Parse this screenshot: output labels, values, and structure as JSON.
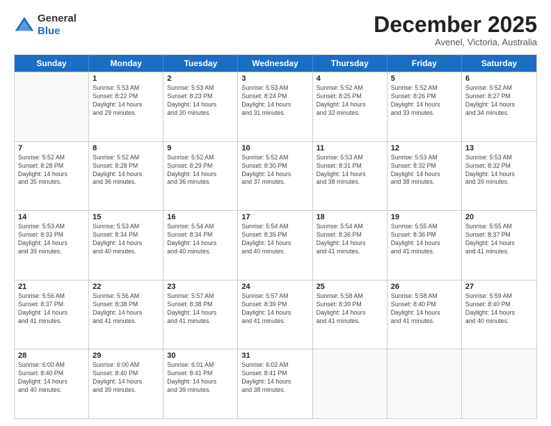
{
  "logo": {
    "general": "General",
    "blue": "Blue"
  },
  "title": "December 2025",
  "subtitle": "Avenel, Victoria, Australia",
  "header_days": [
    "Sunday",
    "Monday",
    "Tuesday",
    "Wednesday",
    "Thursday",
    "Friday",
    "Saturday"
  ],
  "rows": [
    [
      {
        "day": "",
        "info": ""
      },
      {
        "day": "1",
        "info": "Sunrise: 5:53 AM\nSunset: 8:22 PM\nDaylight: 14 hours\nand 29 minutes."
      },
      {
        "day": "2",
        "info": "Sunrise: 5:53 AM\nSunset: 8:23 PM\nDaylight: 14 hours\nand 30 minutes."
      },
      {
        "day": "3",
        "info": "Sunrise: 5:53 AM\nSunset: 8:24 PM\nDaylight: 14 hours\nand 31 minutes."
      },
      {
        "day": "4",
        "info": "Sunrise: 5:52 AM\nSunset: 8:25 PM\nDaylight: 14 hours\nand 32 minutes."
      },
      {
        "day": "5",
        "info": "Sunrise: 5:52 AM\nSunset: 8:26 PM\nDaylight: 14 hours\nand 33 minutes."
      },
      {
        "day": "6",
        "info": "Sunrise: 5:52 AM\nSunset: 8:27 PM\nDaylight: 14 hours\nand 34 minutes."
      }
    ],
    [
      {
        "day": "7",
        "info": "Sunrise: 5:52 AM\nSunset: 8:28 PM\nDaylight: 14 hours\nand 35 minutes."
      },
      {
        "day": "8",
        "info": "Sunrise: 5:52 AM\nSunset: 8:28 PM\nDaylight: 14 hours\nand 36 minutes."
      },
      {
        "day": "9",
        "info": "Sunrise: 5:52 AM\nSunset: 8:29 PM\nDaylight: 14 hours\nand 36 minutes."
      },
      {
        "day": "10",
        "info": "Sunrise: 5:52 AM\nSunset: 8:30 PM\nDaylight: 14 hours\nand 37 minutes."
      },
      {
        "day": "11",
        "info": "Sunrise: 5:53 AM\nSunset: 8:31 PM\nDaylight: 14 hours\nand 38 minutes."
      },
      {
        "day": "12",
        "info": "Sunrise: 5:53 AM\nSunset: 8:32 PM\nDaylight: 14 hours\nand 38 minutes."
      },
      {
        "day": "13",
        "info": "Sunrise: 5:53 AM\nSunset: 8:32 PM\nDaylight: 14 hours\nand 39 minutes."
      }
    ],
    [
      {
        "day": "14",
        "info": "Sunrise: 5:53 AM\nSunset: 8:33 PM\nDaylight: 14 hours\nand 39 minutes."
      },
      {
        "day": "15",
        "info": "Sunrise: 5:53 AM\nSunset: 8:34 PM\nDaylight: 14 hours\nand 40 minutes."
      },
      {
        "day": "16",
        "info": "Sunrise: 5:54 AM\nSunset: 8:34 PM\nDaylight: 14 hours\nand 40 minutes."
      },
      {
        "day": "17",
        "info": "Sunrise: 5:54 AM\nSunset: 8:35 PM\nDaylight: 14 hours\nand 40 minutes."
      },
      {
        "day": "18",
        "info": "Sunrise: 5:54 AM\nSunset: 8:36 PM\nDaylight: 14 hours\nand 41 minutes."
      },
      {
        "day": "19",
        "info": "Sunrise: 5:55 AM\nSunset: 8:36 PM\nDaylight: 14 hours\nand 41 minutes."
      },
      {
        "day": "20",
        "info": "Sunrise: 5:55 AM\nSunset: 8:37 PM\nDaylight: 14 hours\nand 41 minutes."
      }
    ],
    [
      {
        "day": "21",
        "info": "Sunrise: 5:56 AM\nSunset: 8:37 PM\nDaylight: 14 hours\nand 41 minutes."
      },
      {
        "day": "22",
        "info": "Sunrise: 5:56 AM\nSunset: 8:38 PM\nDaylight: 14 hours\nand 41 minutes."
      },
      {
        "day": "23",
        "info": "Sunrise: 5:57 AM\nSunset: 8:38 PM\nDaylight: 14 hours\nand 41 minutes."
      },
      {
        "day": "24",
        "info": "Sunrise: 5:57 AM\nSunset: 8:39 PM\nDaylight: 14 hours\nand 41 minutes."
      },
      {
        "day": "25",
        "info": "Sunrise: 5:58 AM\nSunset: 8:39 PM\nDaylight: 14 hours\nand 41 minutes."
      },
      {
        "day": "26",
        "info": "Sunrise: 5:58 AM\nSunset: 8:40 PM\nDaylight: 14 hours\nand 41 minutes."
      },
      {
        "day": "27",
        "info": "Sunrise: 5:59 AM\nSunset: 8:40 PM\nDaylight: 14 hours\nand 40 minutes."
      }
    ],
    [
      {
        "day": "28",
        "info": "Sunrise: 6:00 AM\nSunset: 8:40 PM\nDaylight: 14 hours\nand 40 minutes."
      },
      {
        "day": "29",
        "info": "Sunrise: 6:00 AM\nSunset: 8:40 PM\nDaylight: 14 hours\nand 39 minutes."
      },
      {
        "day": "30",
        "info": "Sunrise: 6:01 AM\nSunset: 8:41 PM\nDaylight: 14 hours\nand 39 minutes."
      },
      {
        "day": "31",
        "info": "Sunrise: 6:02 AM\nSunset: 8:41 PM\nDaylight: 14 hours\nand 38 minutes."
      },
      {
        "day": "",
        "info": ""
      },
      {
        "day": "",
        "info": ""
      },
      {
        "day": "",
        "info": ""
      }
    ]
  ]
}
